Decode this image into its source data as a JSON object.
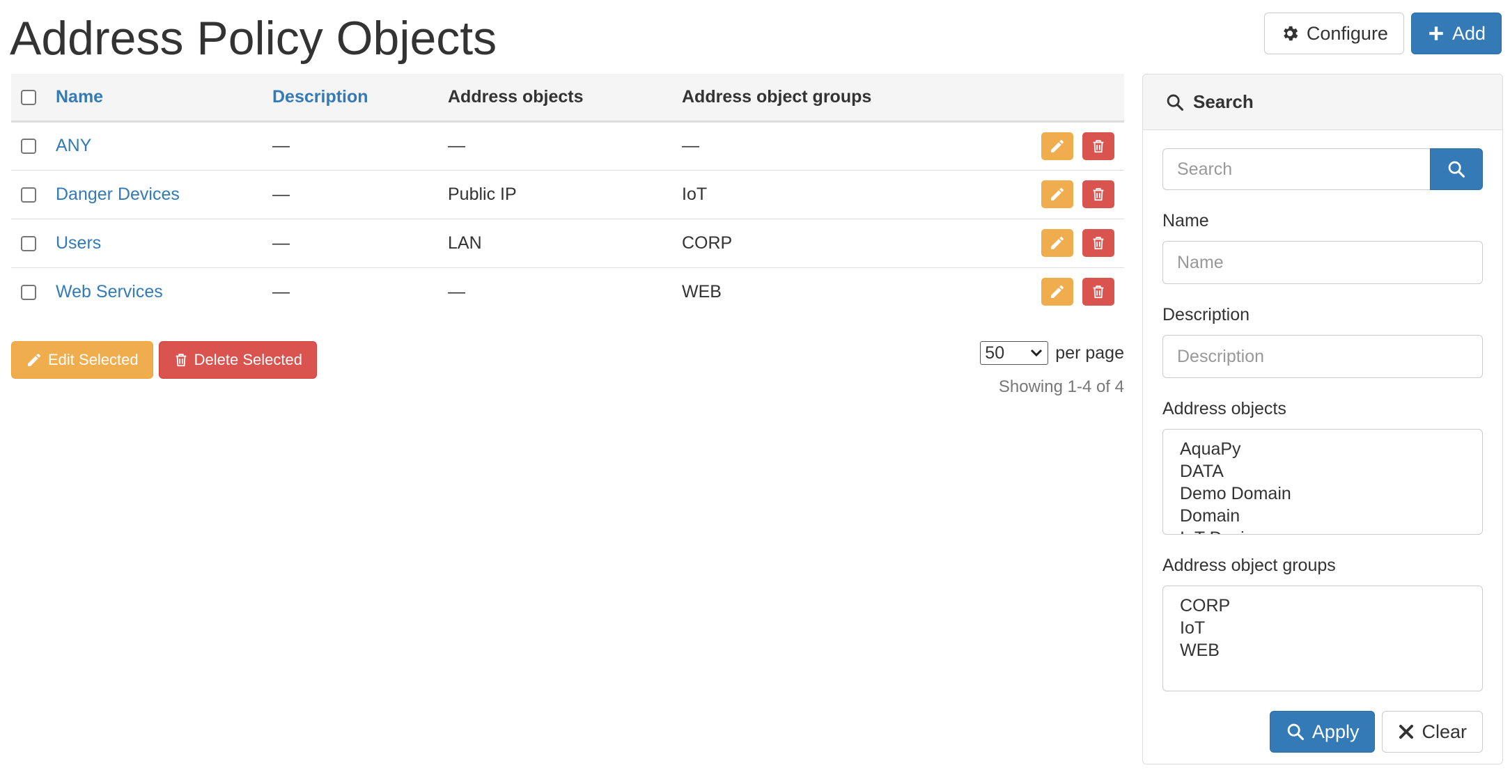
{
  "page": {
    "title": "Address Policy Objects"
  },
  "toolbar": {
    "configure_label": "Configure",
    "add_label": "Add"
  },
  "table": {
    "columns": {
      "name": "Name",
      "description": "Description",
      "address_objects": "Address objects",
      "address_object_groups": "Address object groups"
    },
    "rows": [
      {
        "name": "ANY",
        "description": "—",
        "address_objects": "—",
        "address_object_groups": "—"
      },
      {
        "name": "Danger Devices",
        "description": "—",
        "address_objects": "Public IP",
        "address_object_groups": "IoT"
      },
      {
        "name": "Users",
        "description": "—",
        "address_objects": "LAN",
        "address_object_groups": "CORP"
      },
      {
        "name": "Web Services",
        "description": "—",
        "address_objects": "—",
        "address_object_groups": "WEB"
      }
    ]
  },
  "bulk": {
    "edit_label": "Edit Selected",
    "delete_label": "Delete Selected"
  },
  "pagination": {
    "per_page_value": "50",
    "per_page_label": "per page",
    "showing": "Showing 1-4 of 4"
  },
  "search_panel": {
    "title": "Search",
    "search_placeholder": "Search",
    "name_label": "Name",
    "name_placeholder": "Name",
    "description_label": "Description",
    "description_placeholder": "Description",
    "address_objects_label": "Address objects",
    "address_objects_options": [
      "AquaPy",
      "DATA",
      "Demo Domain",
      "Domain",
      "IoT Devices"
    ],
    "address_object_groups_label": "Address object groups",
    "address_object_groups_options": [
      "CORP",
      "IoT",
      "WEB"
    ],
    "apply_label": "Apply",
    "clear_label": "Clear"
  },
  "colors": {
    "primary": "#337ab7",
    "warning": "#f0ad4e",
    "danger": "#d9534f",
    "link": "#337ab7"
  }
}
